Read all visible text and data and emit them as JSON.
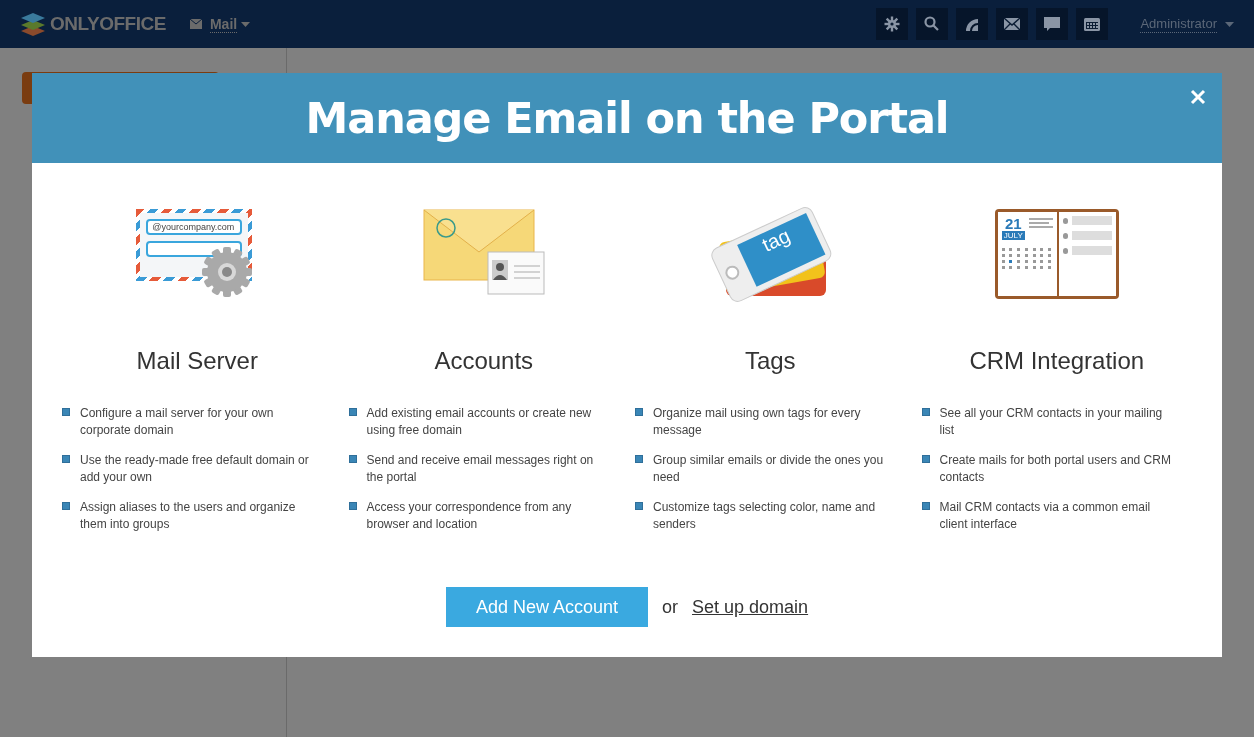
{
  "topbar": {
    "logo": "ONLYOFFICE",
    "module": "Mail",
    "user": "Administrator"
  },
  "dialog": {
    "title": "Manage Email on the Portal",
    "features": [
      {
        "kind": "server",
        "illustration_text": "@yourcompany.com",
        "title": "Mail Server",
        "points": [
          "Configure a mail server for your own corporate domain",
          "Use the ready-made free default domain or add your own",
          "Assign aliases to the users and organize them into groups"
        ]
      },
      {
        "kind": "accounts",
        "title": "Accounts",
        "points": [
          "Add existing email accounts or create new using free domain",
          "Send and receive email messages right on the portal",
          "Access your correspondence from any browser and location"
        ]
      },
      {
        "kind": "tags",
        "illustration_text": "tag",
        "title": "Tags",
        "points": [
          "Organize mail using own tags for every message",
          "Group similar emails or divide the ones you need",
          "Customize tags selecting color, name and senders"
        ]
      },
      {
        "kind": "crm",
        "illustration_text": "21",
        "illustration_subtext": "JULY",
        "title": "CRM Integration",
        "points": [
          "See all your CRM contacts in your mailing list",
          "Create mails for both portal users and CRM contacts",
          "Mail CRM contacts via a common email client interface"
        ]
      }
    ],
    "primary_button": "Add New Account",
    "separator": "or",
    "link": "Set up domain"
  }
}
